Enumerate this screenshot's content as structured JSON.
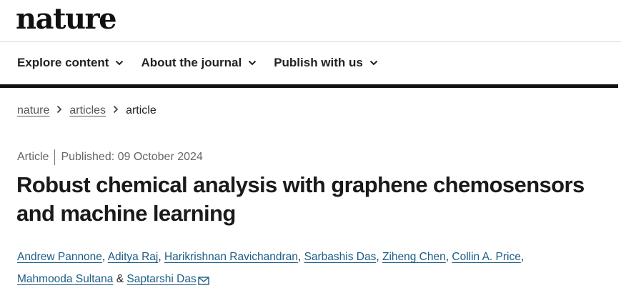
{
  "header": {
    "logo_text": "nature"
  },
  "nav": {
    "items": [
      {
        "label": "Explore content"
      },
      {
        "label": "About the journal"
      },
      {
        "label": "Publish with us"
      }
    ]
  },
  "breadcrumb": {
    "items": [
      "nature",
      "articles"
    ],
    "current": "article"
  },
  "article": {
    "type": "Article",
    "published": "Published: 09 October 2024",
    "title": "Robust chemical analysis with graphene chemosensors and machine learning",
    "authors": [
      "Andrew Pannone",
      "Aditya Raj",
      "Harikrishnan Ravichandran",
      "Sarbashis Das",
      "Ziheng Chen",
      "Collin A. Price",
      "Mahmooda Sultana",
      "Saptarshi Das"
    ],
    "author_separator": ", ",
    "last_separator": " & "
  },
  "icons": {
    "nav_chevron": "chevron-down-icon",
    "breadcrumb_separator": "chevron-right-icon",
    "corresponding_author": "envelope-icon"
  },
  "colors": {
    "link": "#1d5d86",
    "text": "#222222",
    "muted": "#666666"
  }
}
